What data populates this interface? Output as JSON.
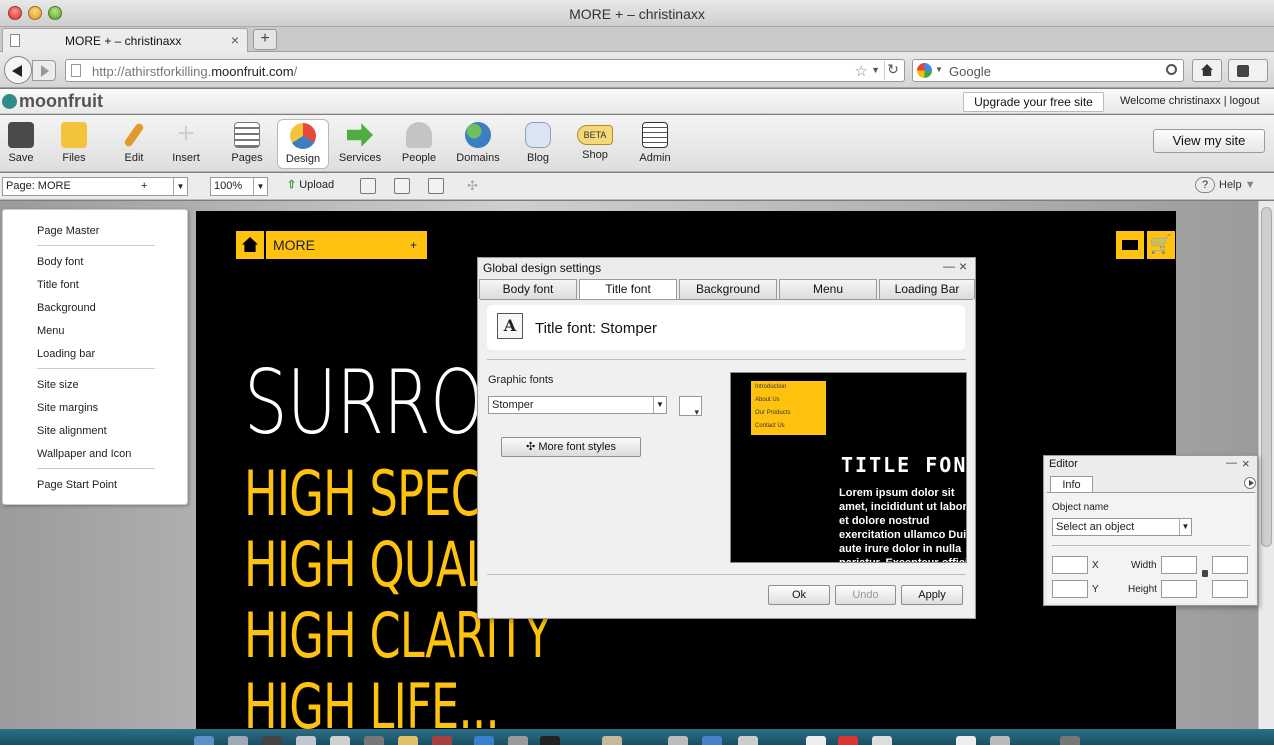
{
  "browser": {
    "window_title": "MORE + – christinaxx",
    "tab_title": "MORE + – christinaxx",
    "new_tab": "+",
    "url_prefix": "http://athirstforkilling.",
    "url_domain": "moonfruit.com",
    "url_suffix": "/",
    "search_placeholder": "Google"
  },
  "app": {
    "logo": "moonfruit",
    "upgrade": "Upgrade your free site",
    "welcome": "Welcome christinaxx | logout",
    "view_site": "View my site",
    "tools": [
      {
        "label": "Save",
        "icon": "floppy-icon",
        "color": "#4a4a4a"
      },
      {
        "label": "Files",
        "icon": "folder-icon",
        "color": "#f2c33b"
      },
      {
        "label": "Edit",
        "icon": "pencil-icon",
        "color": "#e39a2b"
      },
      {
        "label": "Insert",
        "icon": "plus-icon",
        "color": "#d9d9d9"
      },
      {
        "label": "Pages",
        "icon": "pages-icon",
        "color": "#9a9a9a"
      },
      {
        "label": "Design",
        "icon": "palette-icon",
        "color": "#e8473b"
      },
      {
        "label": "Services",
        "icon": "arrow-icon",
        "color": "#4fae3f"
      },
      {
        "label": "People",
        "icon": "people-icon",
        "color": "#b8b8b8"
      },
      {
        "label": "Domains",
        "icon": "globe-icon",
        "color": "#3b7ec2"
      },
      {
        "label": "Blog",
        "icon": "speech-bubble-icon",
        "color": "#c9d9ec"
      },
      {
        "label": "Shop",
        "icon": "beta-tag-icon",
        "color": "#f2d16b"
      },
      {
        "label": "Admin",
        "icon": "document-icon",
        "color": "#ffffff"
      }
    ],
    "active_tool": "Design",
    "page_select": "Page: MORE",
    "page_select_plus": "+",
    "zoom": "100%",
    "upload": "Upload",
    "help": "Help"
  },
  "left_panel": {
    "items": [
      "Page Master",
      "Body font",
      "Title font",
      "Background",
      "Menu",
      "Loading bar",
      "Site size",
      "Site margins",
      "Site alignment",
      "Wallpaper and Icon",
      "Page Start Point"
    ]
  },
  "site": {
    "menu": "MORE",
    "menu_plus": "+",
    "cart": "🛒",
    "headline": "SURRO",
    "taglines": [
      "HIGH SPEC",
      "HIGH QUAL",
      "HIGH CLARITY",
      "HIGH LIFE..."
    ],
    "accent": "#ffc20e"
  },
  "dialog": {
    "title": "Global design settings",
    "tabs": [
      "Body font",
      "Title font",
      "Background",
      "Menu",
      "Loading Bar"
    ],
    "active_tab": "Title font",
    "heading": "Title font: Stomper",
    "graphic_fonts_label": "Graphic fonts",
    "font_value": "Stomper",
    "more_styles": "More font styles",
    "preview_menu": [
      "Introduction",
      "About Us",
      "Our Products",
      "Contact Us"
    ],
    "preview_title": "TITLE FONT",
    "preview_text": "Lorem ipsum dolor sit amet, incididunt ut labore et dolore nostrud exercitation ullamco Duis aute irure dolor in nulla pariatur. Excepteur officia deserunt mollit",
    "ok": "Ok",
    "undo": "Undo",
    "apply": "Apply"
  },
  "editor": {
    "title": "Editor",
    "tab": "Info",
    "object_name_label": "Object name",
    "object_select": "Select an object",
    "x_label": "X",
    "y_label": "Y",
    "width_label": "Width",
    "height_label": "Height"
  }
}
